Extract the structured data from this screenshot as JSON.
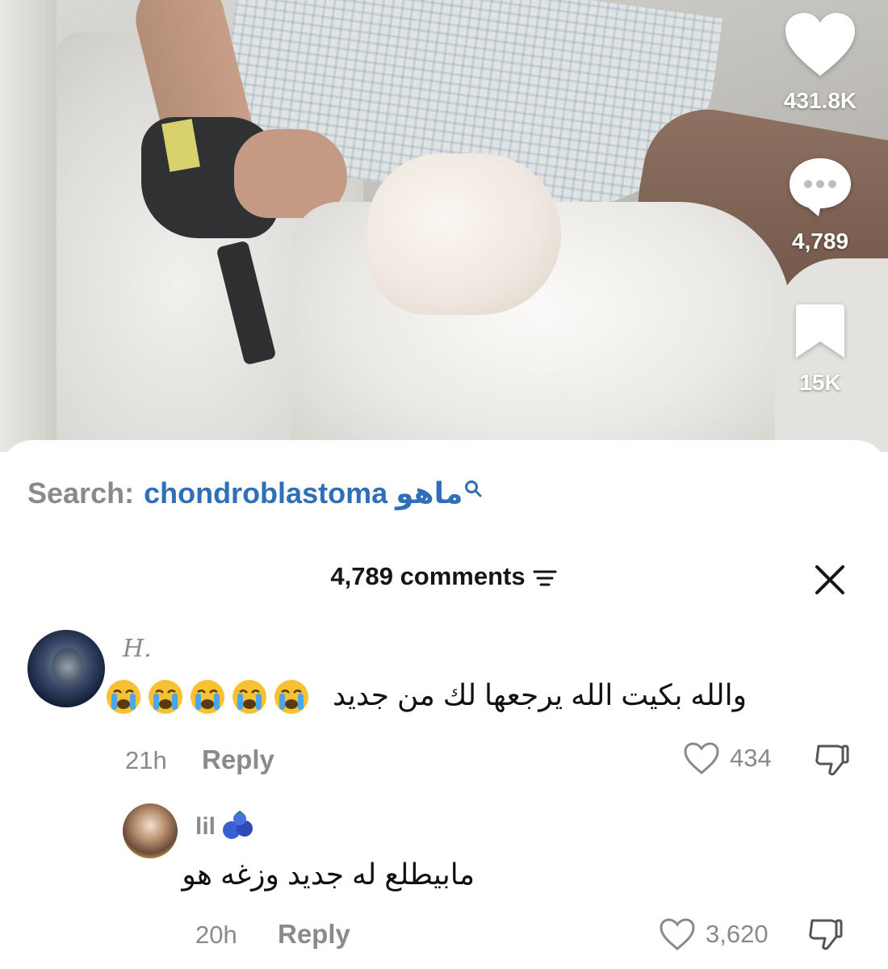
{
  "video": {
    "actions": {
      "likes": "431.8K",
      "comments": "4,789",
      "saves": "15K"
    }
  },
  "search": {
    "prefix": "Search:",
    "term": "chondroblastoma ماهو"
  },
  "comments_panel": {
    "header": "4,789 comments",
    "comments": [
      {
        "username": "H.",
        "text": "والله بكيت الله يرجعها لك من جديد",
        "emoji": "😭😭😭😭😭",
        "time": "21h",
        "reply_label": "Reply",
        "likes": "434"
      },
      {
        "username": "lil",
        "text": "مابيطلع له جديد وزغه هو",
        "time": "20h",
        "reply_label": "Reply",
        "likes": "3,620"
      }
    ]
  },
  "colors": {
    "search_term": "#2f6fb8",
    "muted": "#8a8a8a",
    "text": "#111111"
  },
  "icons": [
    "heart-icon",
    "comment-bubble-icon",
    "bookmark-icon",
    "search-icon",
    "filter-icon",
    "close-icon",
    "dislike-icon",
    "blueberry-emoji-icon",
    "crying-face-emoji-icon"
  ]
}
